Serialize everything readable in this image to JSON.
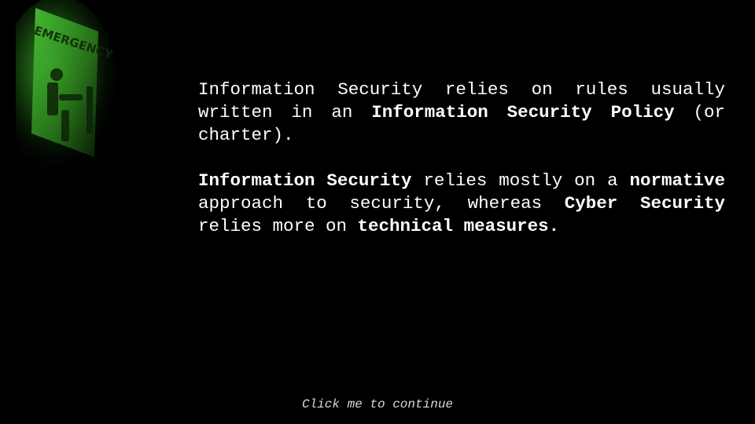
{
  "paragraph_1": {
    "part_1": "Information Security relies on rules usually written in an ",
    "bold_1": "Information Security Policy",
    "part_2": " (or charter)."
  },
  "paragraph_2": {
    "bold_1": "Information Security",
    "part_1": " relies mostly on a ",
    "bold_2": "normative",
    "part_2": " approach to security, whereas ",
    "bold_3": "Cyber Security",
    "part_3": " relies more on ",
    "bold_4": "technical measures",
    "part_4": "."
  },
  "continue_prompt": "Click me to continue",
  "sign_text": "EMERGENCY"
}
